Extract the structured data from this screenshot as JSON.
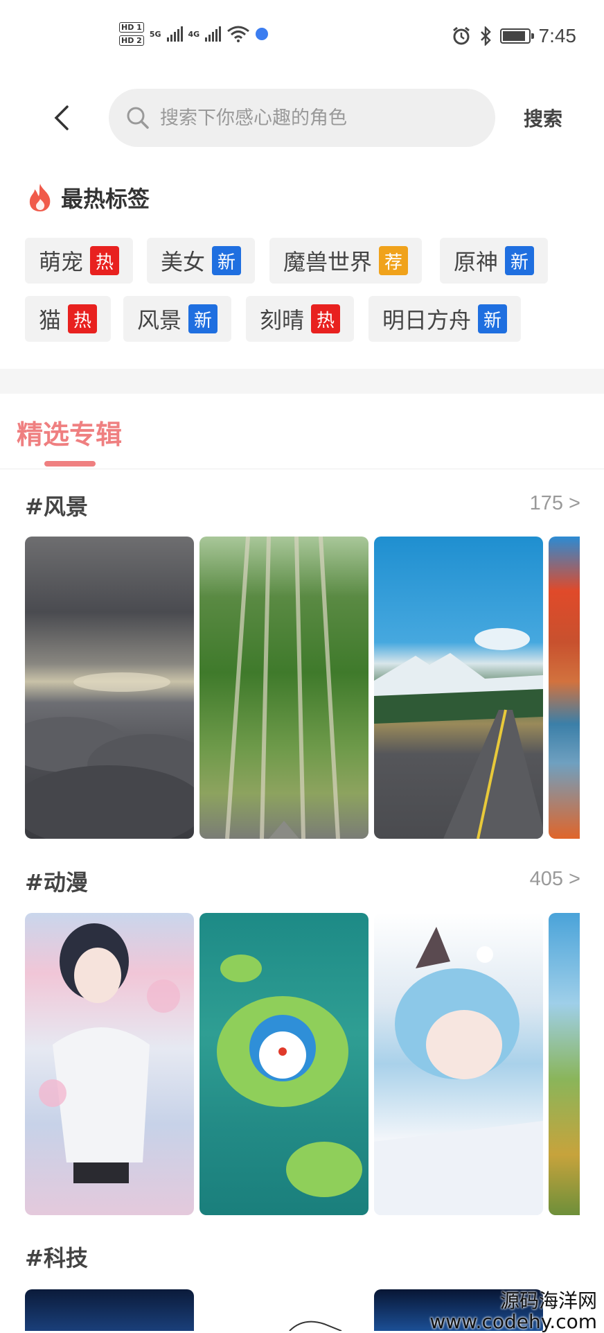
{
  "status_bar": {
    "hd1": "HD 1",
    "hd2": "HD 2",
    "net1": "5G",
    "net2": "4G",
    "time": "7:45"
  },
  "header": {
    "search_placeholder": "搜索下你感心趣的角色",
    "search_button": "搜索"
  },
  "hot_tags": {
    "title": "最热标签",
    "items": [
      {
        "name": "萌宠",
        "badge": "热",
        "badge_color": "#e8211f"
      },
      {
        "name": "美女",
        "badge": "新",
        "badge_color": "#1f6fe0"
      },
      {
        "name": "魔兽世界",
        "badge": "荐",
        "badge_color": "#f0a21b"
      },
      {
        "name": "原神",
        "badge": "新",
        "badge_color": "#1f6fe0"
      },
      {
        "name": "猫",
        "badge": "热",
        "badge_color": "#e8211f"
      },
      {
        "name": "风景",
        "badge": "新",
        "badge_color": "#1f6fe0"
      },
      {
        "name": "刻晴",
        "badge": "热",
        "badge_color": "#e8211f"
      },
      {
        "name": "明日方舟",
        "badge": "新",
        "badge_color": "#1f6fe0"
      }
    ]
  },
  "featured": {
    "tab_label": "精选专辑",
    "accent_color": "#ef7f80"
  },
  "categories": [
    {
      "title": "#风景",
      "count": "175 >"
    },
    {
      "title": "#动漫",
      "count": "405 >"
    },
    {
      "title": "#科技",
      "count": ""
    }
  ],
  "watermark": {
    "line1": "源码海洋网",
    "line2": "www.codehy.com"
  }
}
